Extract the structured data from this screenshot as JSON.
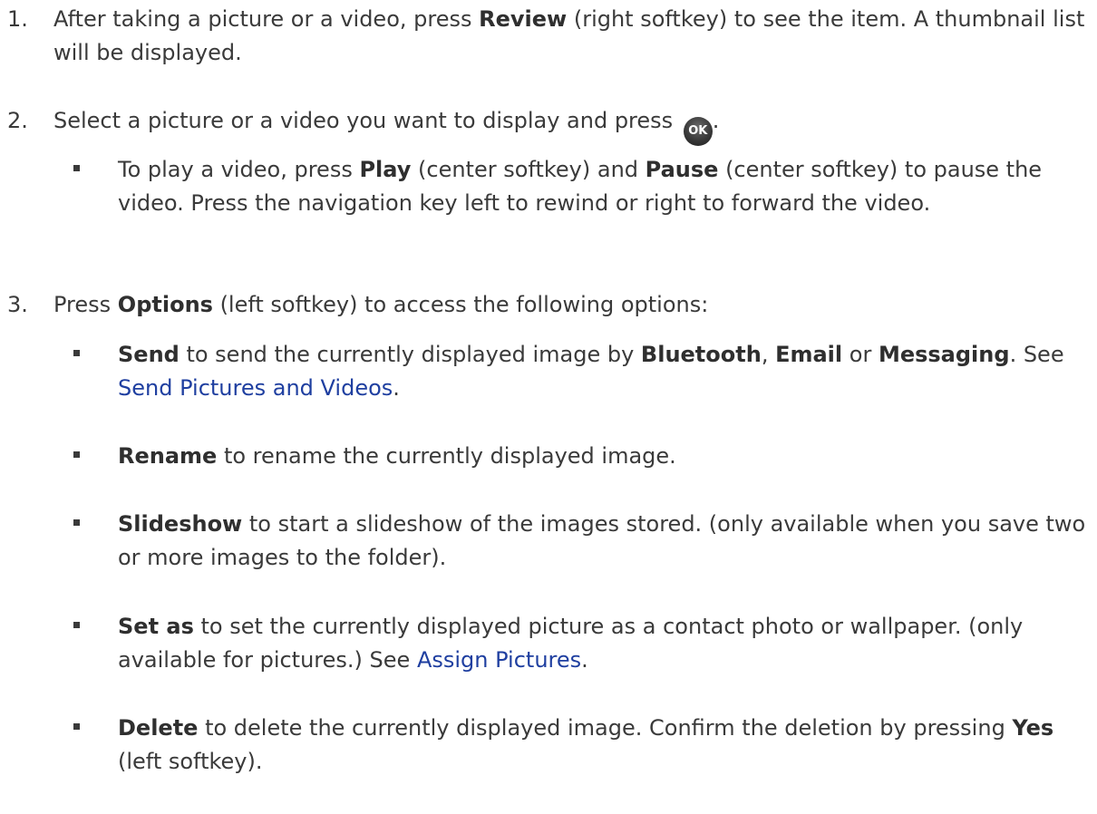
{
  "steps": [
    {
      "num": "1.",
      "before": "After taking a picture or a video, press ",
      "bold": "Review",
      "after": " (right softkey) to see the item. A thumbnail list will be displayed."
    },
    {
      "num": "2.",
      "text": "Select a picture or a video you want to display and press ",
      "ok_label": "OK",
      "end": "."
    },
    {
      "num": "3.",
      "before": "Press ",
      "bold": "Options",
      "after": " (left softkey) to access the following options:"
    }
  ],
  "play_bullet": {
    "t1": "To play a video, press ",
    "b1": "Play",
    "t2": " (center softkey) and ",
    "b2": "Pause",
    "t3": " (center softkey) to pause the video. Press the navigation key left to rewind or right to forward the video."
  },
  "options": [
    {
      "bold": "Send",
      "t1": " to send the currently displayed image by ",
      "b2": "Bluetooth",
      "t2": ", ",
      "b3": "Email",
      "t3": " or ",
      "b4": "Messaging",
      "t4": ". See ",
      "link": "Send Pictures and Videos",
      "t5": "."
    },
    {
      "bold": "Rename",
      "text": " to rename the currently displayed image."
    },
    {
      "bold": "Slideshow",
      "text": " to start a slideshow of the images stored. (only available when you save two or more images to the folder)."
    },
    {
      "bold": "Set as",
      "text": " to set the currently displayed picture as a contact photo or wallpaper. (only available for pictures.) See ",
      "link": "Assign Pictures",
      "end": "."
    },
    {
      "bold": "Delete",
      "text": " to delete the currently displayed image. Confirm the deletion by pressing ",
      "b2": "Yes",
      "end": " (left softkey)."
    }
  ]
}
